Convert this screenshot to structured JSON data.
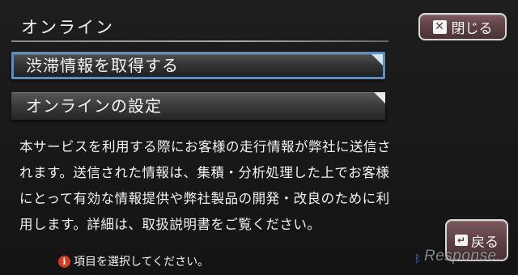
{
  "header": {
    "title": "オンライン",
    "close_icon_glyph": "✕",
    "close_label": "閉じる"
  },
  "menu": {
    "items": [
      {
        "label": "渋滞情報を取得する",
        "selected": true
      },
      {
        "label": "オンラインの設定",
        "selected": false
      }
    ]
  },
  "description": {
    "lines": [
      "本サービスを利用する際にお客様の走行情報が弊社に送信さ",
      "れます。送信された情報は、集積・分析処理した上でお客様",
      "にとって有効な情報提供や弊社製品の開発・改良のために利",
      "用します。詳細は、取扱説明書をご覧ください。"
    ]
  },
  "footer": {
    "info_icon_glyph": "i",
    "status_text": "項目を選択してください。",
    "back_icon_glyph": "↵",
    "back_label": "戻る",
    "bluetooth_glyph": "ᛒ",
    "watermark": "Response."
  },
  "colors": {
    "button_bg": "#5b3f43",
    "selected_border": "#5a8fc0",
    "info_red": "#d33a1f",
    "bluetooth_blue": "#3b7fd6"
  }
}
